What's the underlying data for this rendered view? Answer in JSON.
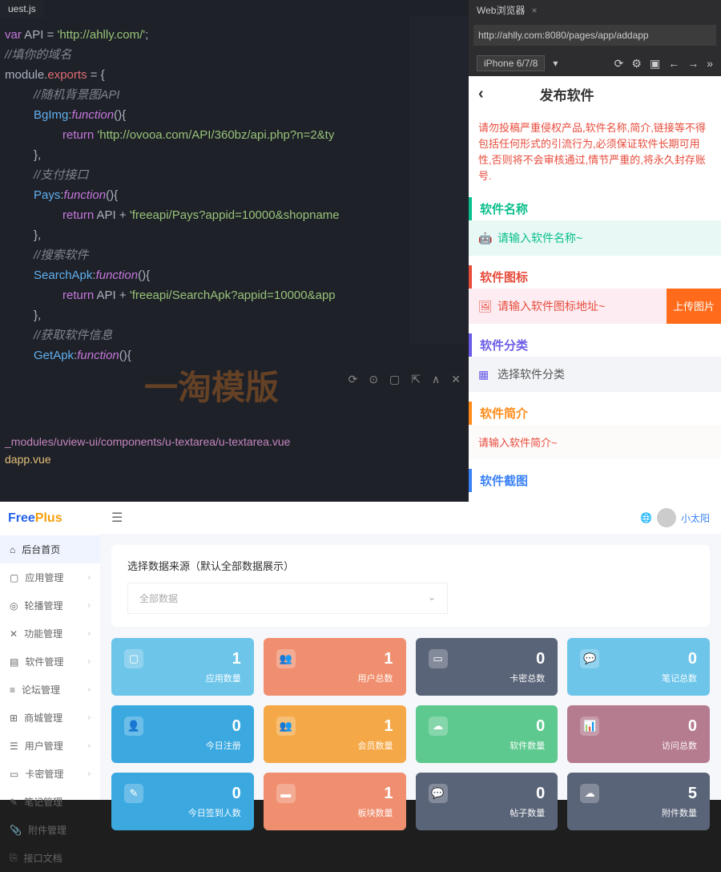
{
  "editor": {
    "tab": "uest.js",
    "code_lines": [
      {
        "pre": "",
        "t": "var",
        "ty": "kw"
      },
      {
        "t": " API "
      },
      {
        "t": "=",
        "ty": "op"
      },
      {
        "t": " "
      },
      {
        "t": "'http://ahlly.com/'",
        "ty": "st"
      },
      {
        "t": ";"
      },
      "\n",
      {
        "t": "//填你的域名",
        "ty": "cm"
      },
      "\n",
      {
        "t": "module"
      },
      {
        "t": ".",
        "ty": "op"
      },
      {
        "t": "exports",
        "ty": "pr"
      },
      {
        "t": " = {"
      },
      "\n",
      {
        "pre": "    ",
        "t": "//随机背景图API",
        "ty": "cm"
      },
      "\n",
      {
        "pre": "    ",
        "t": "BgImg",
        "ty": "fn"
      },
      {
        "t": ":"
      },
      {
        "t": "function",
        "ty": "kw",
        "i": 1
      },
      {
        "t": "(){"
      },
      "\n",
      {
        "pre": "        ",
        "t": "return",
        "ty": "rt"
      },
      {
        "t": " "
      },
      {
        "t": "'http://ovooa.com/API/360bz/api.php?n=2&ty",
        "ty": "st"
      },
      "\n",
      {
        "pre": "    ",
        "t": "},"
      },
      "\n",
      {
        "pre": "    ",
        "t": "//支付接口",
        "ty": "cm"
      },
      "\n",
      {
        "pre": "    ",
        "t": "Pays",
        "ty": "fn"
      },
      {
        "t": ":"
      },
      {
        "t": "function",
        "ty": "kw",
        "i": 1
      },
      {
        "t": "(){"
      },
      "\n",
      {
        "pre": "        ",
        "t": "return",
        "ty": "rt"
      },
      {
        "t": " API "
      },
      {
        "t": "+ "
      },
      {
        "t": "'freeapi/Pays?appid=10000&shopname",
        "ty": "st"
      },
      "\n",
      {
        "pre": "    ",
        "t": "},"
      },
      "\n",
      {
        "pre": "    ",
        "t": "//搜索软件",
        "ty": "cm"
      },
      "\n",
      {
        "pre": "    ",
        "t": "SearchApk",
        "ty": "fn"
      },
      {
        "t": ":"
      },
      {
        "t": "function",
        "ty": "kw",
        "i": 1
      },
      {
        "t": "(){"
      },
      "\n",
      {
        "pre": "        ",
        "t": "return",
        "ty": "rt"
      },
      {
        "t": " API "
      },
      {
        "t": "+ "
      },
      {
        "t": "'freeapi/SearchApk?appid=10000&app",
        "ty": "st"
      },
      "\n",
      {
        "pre": "    ",
        "t": "},"
      },
      "\n",
      {
        "pre": "    ",
        "t": "//获取软件信息",
        "ty": "cm"
      },
      "\n",
      {
        "pre": "    ",
        "t": "GetApk",
        "ty": "fn"
      },
      {
        "t": ":"
      },
      {
        "t": "function",
        "ty": "kw",
        "i": 1
      },
      {
        "t": "(){"
      }
    ],
    "term1": "_modules/uview-ui/components/u-textarea/u-textarea.vue",
    "term2": "dapp.vue",
    "toolbar_icons": [
      "⟳",
      "⊙",
      "▢",
      "⇱",
      "∧",
      "✕"
    ]
  },
  "browser": {
    "tab": "Web浏览器",
    "url": "http://ahlly.com:8080/pages/app/addapp",
    "device": "iPhone 6/7/8",
    "title": "发布软件",
    "warning": "请勿投稿严重侵权产品,软件名称,简介,链接等不得包括任何形式的引流行为,必须保证软件长期可用性,否则将不会审核通过,情节严重的,将永久封存账号.",
    "sections": {
      "name": {
        "h": "软件名称",
        "ph": "请输入软件名称~"
      },
      "icon": {
        "h": "软件图标",
        "ph": "请输入软件图标地址~",
        "btn": "上传图片"
      },
      "cat": {
        "h": "软件分类",
        "ph": "选择软件分类"
      },
      "desc": {
        "h": "软件简介",
        "ph": "请输入软件简介~"
      },
      "shot": {
        "h": "软件截图"
      }
    }
  },
  "admin": {
    "logo1": "Free",
    "logo2": "Plus",
    "user": "小太阳",
    "menu": [
      {
        "i": "⌂",
        "l": "后台首页",
        "act": 1
      },
      {
        "i": "▢",
        "l": "应用管理",
        "ar": 1
      },
      {
        "i": "◎",
        "l": "轮播管理",
        "ar": 1
      },
      {
        "i": "✕",
        "l": "功能管理",
        "ar": 1
      },
      {
        "i": "▤",
        "l": "软件管理",
        "ar": 1
      },
      {
        "i": "≡",
        "l": "论坛管理",
        "ar": 1
      },
      {
        "i": "⊞",
        "l": "商城管理",
        "ar": 1
      },
      {
        "i": "☰",
        "l": "用户管理",
        "ar": 1
      },
      {
        "i": "▭",
        "l": "卡密管理",
        "ar": 1
      },
      {
        "i": "✎",
        "l": "笔记管理"
      },
      {
        "i": "📎",
        "l": "附件管理"
      },
      {
        "i": "⎘",
        "l": "接口文档"
      }
    ],
    "panel": {
      "t": "选择数据来源（默认全部数据展示）",
      "sel": "全部数据"
    },
    "cards": [
      {
        "c": "c1",
        "i": "▢",
        "n": "1",
        "l": "应用数量"
      },
      {
        "c": "c2",
        "i": "👥",
        "n": "1",
        "l": "用户总数"
      },
      {
        "c": "c3",
        "i": "▭",
        "n": "0",
        "l": "卡密总数"
      },
      {
        "c": "c4",
        "i": "💬",
        "n": "0",
        "l": "笔记总数"
      },
      {
        "c": "c5",
        "i": "👤",
        "n": "0",
        "l": "今日注册"
      },
      {
        "c": "c6",
        "i": "👥",
        "n": "1",
        "l": "会员数量"
      },
      {
        "c": "c7",
        "i": "☁",
        "n": "0",
        "l": "软件数量"
      },
      {
        "c": "c8",
        "i": "📊",
        "n": "0",
        "l": "访问总数"
      },
      {
        "c": "c9",
        "i": "✎",
        "n": "0",
        "l": "今日签到人数"
      },
      {
        "c": "c10",
        "i": "▬",
        "n": "1",
        "l": "板块数量"
      },
      {
        "c": "c11",
        "i": "💬",
        "n": "0",
        "l": "帖子数量"
      },
      {
        "c": "c12",
        "i": "☁",
        "n": "5",
        "l": "附件数量"
      }
    ]
  }
}
